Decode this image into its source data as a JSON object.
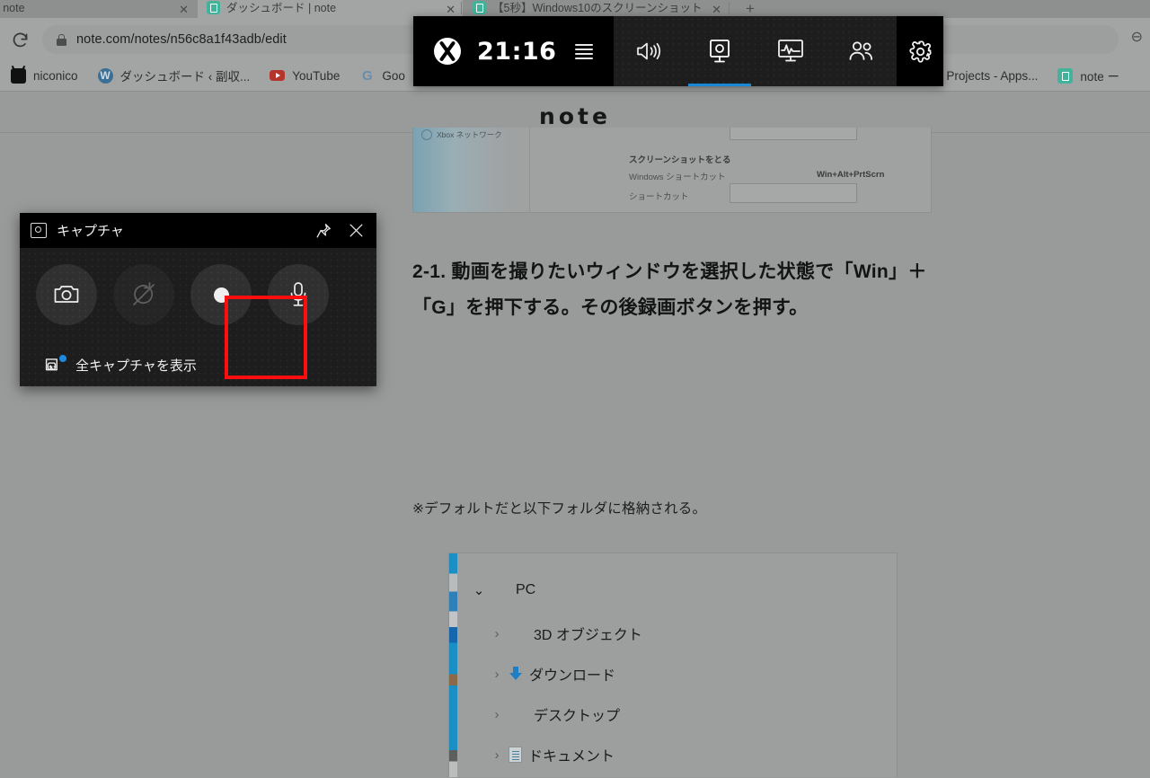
{
  "browser": {
    "tabs": [
      {
        "title": "編集 | note",
        "active": false,
        "has_favicon": false
      },
      {
        "title": "ダッシュボード | note",
        "active": true,
        "has_favicon": true
      },
      {
        "title": "【5秒】Windows10のスクリーンショット",
        "active": false,
        "has_favicon": true
      }
    ],
    "new_tab_label": "+",
    "close_label": "✕",
    "reload_label": "reload-icon",
    "address": {
      "url": "note.com/notes/n56c8a1f43adb/edit",
      "lock": "lock-icon",
      "right_icon": "⊖"
    },
    "bookmarks": [
      {
        "label": "niconico",
        "icon": "niconico-icon"
      },
      {
        "label": "ダッシュボード ‹ 副収...",
        "icon": "wordpress-icon"
      },
      {
        "label": "YouTube",
        "icon": "youtube-icon"
      },
      {
        "label": "Goo",
        "icon": "google-icon"
      },
      {
        "label": "y Projects - Apps...",
        "icon": "apps-icon"
      },
      {
        "label": "note ー",
        "icon": "note-icon"
      }
    ]
  },
  "note_page": {
    "logo": "note",
    "embedded_settings": {
      "nav_item": "Xbox ネットワーク",
      "section_title": "スクリーンショットをとる",
      "rows": [
        {
          "label": "Windows ショートカット",
          "value": "Win+Alt+PrtScrn"
        },
        {
          "label": "ショートカット",
          "value": ""
        }
      ]
    },
    "headline": "2-1. 動画を撮りたいウィンドウを選択した状態で「Win」＋「G」を押下する。その後録画ボタンを押す。",
    "note_text": "※デフォルトだと以下フォルダに格納される。",
    "explorer": {
      "items": [
        {
          "label": "PC",
          "icon": "pc-icon",
          "expanded": true,
          "chevron": "⌄",
          "indent": 0
        },
        {
          "label": "3D オブジェクト",
          "icon": "3d-objects-icon",
          "expanded": false,
          "chevron": "›",
          "indent": 1
        },
        {
          "label": "ダウンロード",
          "icon": "downloads-icon",
          "expanded": false,
          "chevron": "›",
          "indent": 1
        },
        {
          "label": "デスクトップ",
          "icon": "desktop-icon",
          "expanded": false,
          "chevron": "›",
          "indent": 1
        },
        {
          "label": "ドキュメント",
          "icon": "documents-icon",
          "expanded": false,
          "chevron": "›",
          "indent": 1
        }
      ]
    }
  },
  "game_bar": {
    "xbox_icon": "xbox-logo-icon",
    "clock": "21:16",
    "menu_icon": "widget-menu-icon",
    "buttons": [
      {
        "name": "audio-icon",
        "label": "オーディオ",
        "active": false
      },
      {
        "name": "capture-icon",
        "label": "キャプチャ",
        "active": true
      },
      {
        "name": "performance-icon",
        "label": "パフォーマンス",
        "active": false
      },
      {
        "name": "xbox-social-icon",
        "label": "Xbox ソーシャル",
        "active": false
      }
    ],
    "settings_icon": "gear-icon",
    "accent_color": "#1688d6"
  },
  "capture_widget": {
    "title": "キャプチャ",
    "title_icon": "capture-icon",
    "pin_label": "pin-icon",
    "close_label": "✕",
    "buttons": [
      {
        "name": "screenshot-button",
        "icon": "camera-icon",
        "disabled": false,
        "highlighted": false
      },
      {
        "name": "record-last-30s-button",
        "icon": "record-last-disabled-icon",
        "disabled": true,
        "highlighted": false
      },
      {
        "name": "start-recording-button",
        "icon": "record-dot-icon",
        "disabled": false,
        "highlighted": true
      },
      {
        "name": "microphone-button",
        "icon": "microphone-icon",
        "disabled": false,
        "highlighted": false
      }
    ],
    "footer_label": "全キャプチャを表示",
    "footer_icon": "all-captures-icon",
    "highlight_color": "#fd0d0d",
    "badge_color": "#1b8ae0"
  }
}
